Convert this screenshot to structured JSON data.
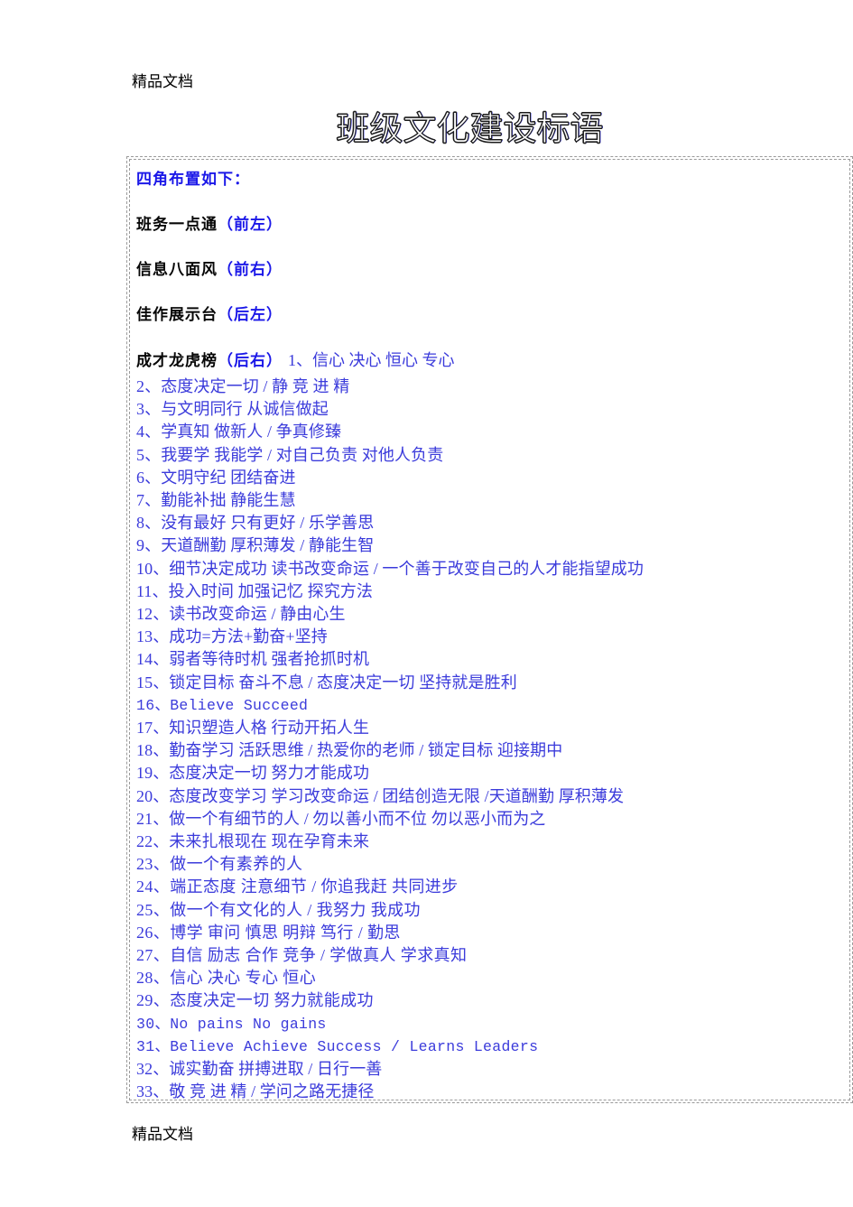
{
  "watermark": {
    "top": "精品文档",
    "bottom": "精品文档"
  },
  "document": {
    "title": "班级文化建设标语"
  },
  "layout_section": {
    "intro": "四角布置如下：",
    "corners": [
      {
        "name": "班务一点通",
        "position": "（前左）"
      },
      {
        "name": "信息八面风",
        "position": "（前右）"
      },
      {
        "name": "佳作展示台",
        "position": "（后左）"
      },
      {
        "name": "成才龙虎榜",
        "position": "（后右）",
        "inline_item": "1、信心 决心 恒心 专心"
      }
    ]
  },
  "slogans": [
    {
      "text": "2、态度决定一切 /  静 竞 进  精",
      "style": "cjk"
    },
    {
      "text": "3、与文明同行  从诚信做起",
      "style": "cjk"
    },
    {
      "text": "4、学真知 做新人 / 争真修臻",
      "style": "cjk"
    },
    {
      "text": "5、我要学 我能学 / 对自己负责 对他人负责",
      "style": "cjk"
    },
    {
      "text": "6、文明守纪 团结奋进",
      "style": "cjk"
    },
    {
      "text": "7、勤能补拙 静能生慧",
      "style": "cjk"
    },
    {
      "text": "8、没有最好 只有更好 / 乐学善思",
      "style": "cjk"
    },
    {
      "text": "9、天道酬勤 厚积薄发  / 静能生智",
      "style": "cjk"
    },
    {
      "text": "10、细节决定成功 读书改变命运 / 一个善于改变自己的人才能指望成功",
      "style": "cjk"
    },
    {
      "text": "11、投入时间 加强记忆 探究方法",
      "style": "cjk"
    },
    {
      "text": "12、读书改变命运  / 静由心生",
      "style": "cjk"
    },
    {
      "text": "13、成功=方法+勤奋+坚持",
      "style": "cjk"
    },
    {
      "text": "14、弱者等待时机 强者抢抓时机",
      "style": "cjk"
    },
    {
      "text": "15、锁定目标 奋斗不息 / 态度决定一切 坚持就是胜利",
      "style": "cjk"
    },
    {
      "text": "16、Believe  Succeed",
      "style": "mono"
    },
    {
      "text": "17、知识塑造人格 行动开拓人生",
      "style": "cjk"
    },
    {
      "text": "18、勤奋学习 活跃思维 / 热爱你的老师 / 锁定目标 迎接期中",
      "style": "cjk"
    },
    {
      "text": "19、态度决定一切  努力才能成功",
      "style": "cjk"
    },
    {
      "text": "20、态度改变学习 学习改变命运  / 团结创造无限 /天道酬勤 厚积薄发",
      "style": "cjk"
    },
    {
      "text": "21、做一个有细节的人 / 勿以善小而不位  勿以恶小而为之",
      "style": "cjk"
    },
    {
      "text": "22、未来扎根现在  现在孕育未来",
      "style": "cjk"
    },
    {
      "text": "23、做一个有素养的人",
      "style": "wide-num"
    },
    {
      "text": "24、端正态度  注意细节  /   你追我赶  共同进步",
      "style": "wide-num"
    },
    {
      "text": "25、做一个有文化的人  /  我努力  我成功",
      "style": "wide-num"
    },
    {
      "text": "26、博学  审问  慎思  明辩  笃行  /   勤思",
      "style": "wide-num"
    },
    {
      "text": "27、自信  励志  合作  竞争  /   学做真人  学求真知",
      "style": "wide-num"
    },
    {
      "text": "28、信心 决心  专心  恒心",
      "style": "wide-num"
    },
    {
      "text": "29、态度决定一切  努力就能成功",
      "style": "wide-num"
    },
    {
      "text": "30、No pains No gains",
      "style": "mono"
    },
    {
      "text": "31、Believe Achieve Success /  Learns Leaders",
      "style": "mono"
    },
    {
      "text": "32、诚实勤奋  拼搏进取  /   日行一善",
      "style": "cjk"
    },
    {
      "text": "33、敬  竞 进  精  /   学问之路无捷径",
      "style": "cjk"
    }
  ]
}
